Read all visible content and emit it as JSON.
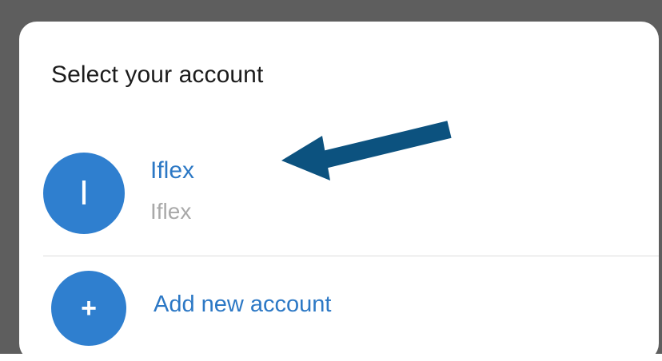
{
  "dialog": {
    "title": "Select your account"
  },
  "account": {
    "avatar_letter": "I",
    "name": "Iflex",
    "subtitle": "Iflex"
  },
  "add_account": {
    "icon_symbol": "+",
    "label": "Add new account"
  },
  "annotation": {
    "icon": "arrow-left-icon",
    "color": "#0c527f"
  },
  "colors": {
    "accent": "#2f7fcf",
    "link_text": "#2c78c5",
    "backdrop": "#5e5e5e"
  }
}
